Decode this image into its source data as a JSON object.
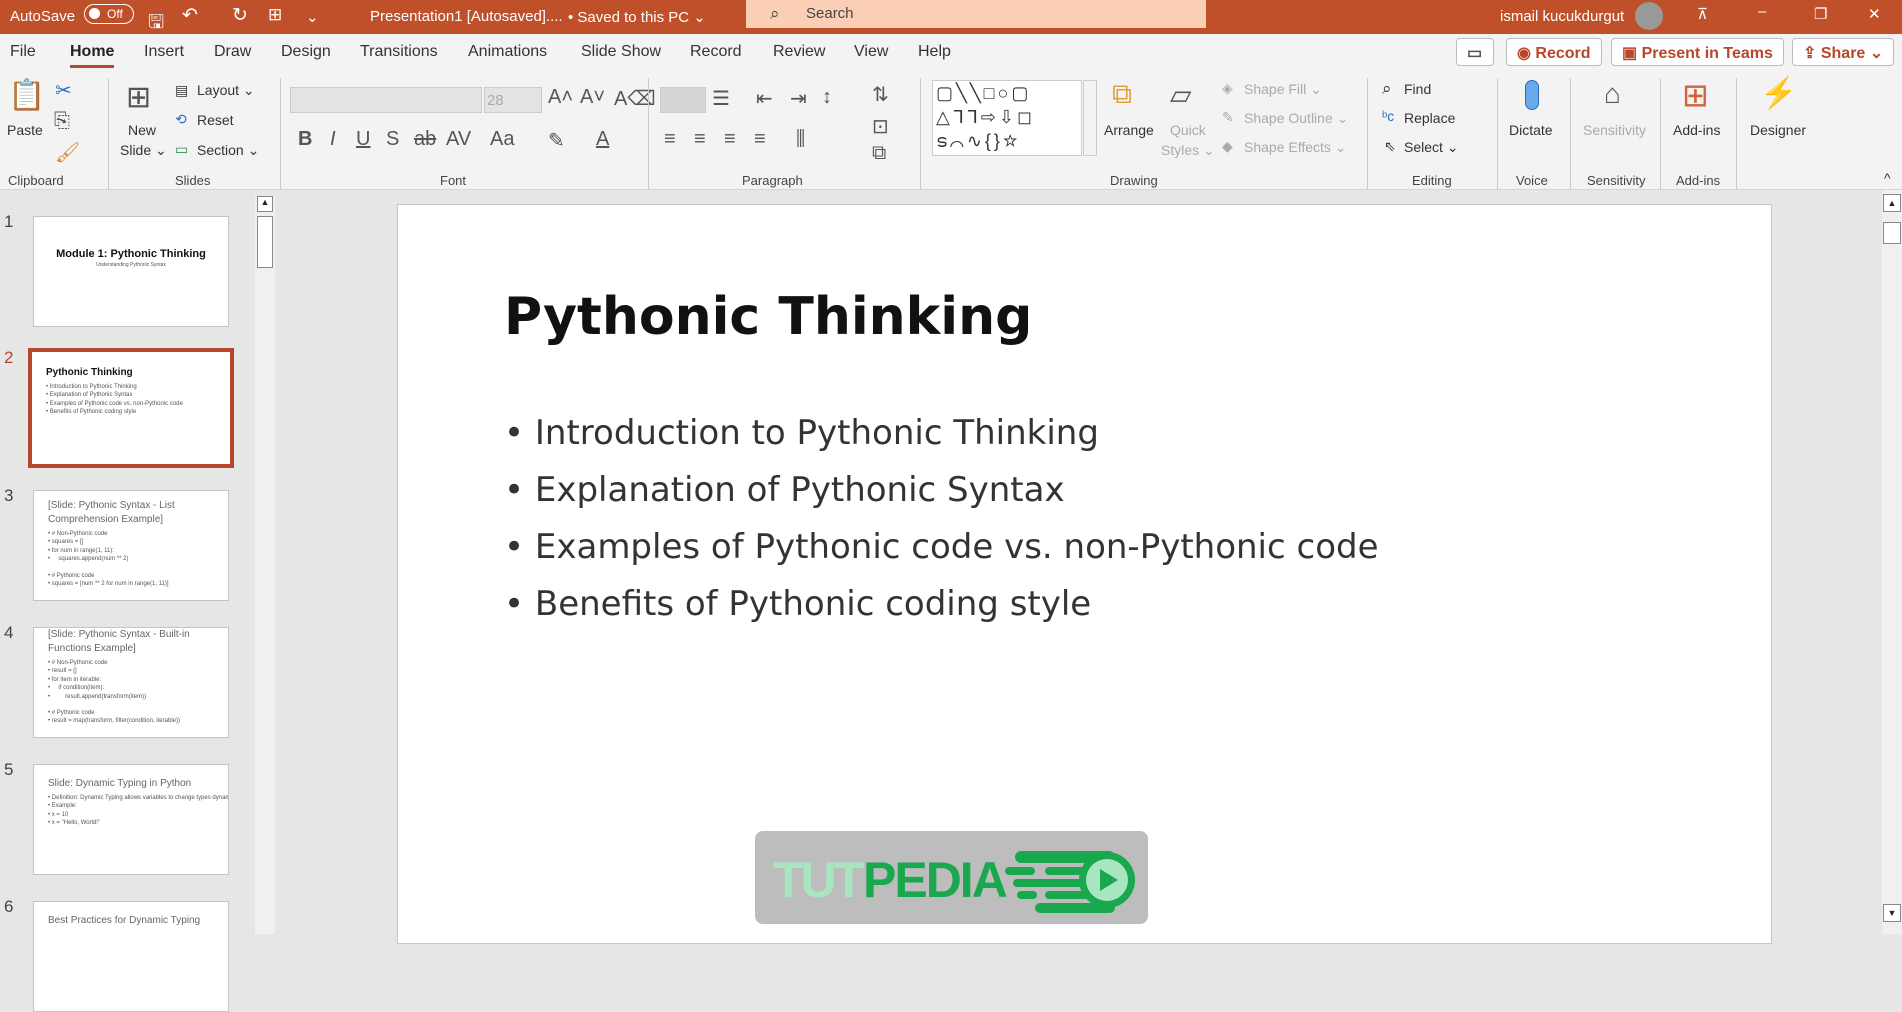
{
  "titlebar": {
    "autosave": "AutoSave",
    "autosave_state": "Off",
    "doc_title": "Presentation1 [Autosaved]....",
    "save_status": "• Saved to this PC ⌄",
    "search_placeholder": "Search",
    "user": "ismail kucukdurgut",
    "accent": "#c0502a"
  },
  "tabs": [
    "File",
    "Home",
    "Insert",
    "Draw",
    "Design",
    "Transitions",
    "Animations",
    "Slide Show",
    "Record",
    "Review",
    "View",
    "Help"
  ],
  "active_tab": "Home",
  "top_buttons": {
    "record": "Record",
    "present": "Present in Teams",
    "share": "Share"
  },
  "ribbon": {
    "clipboard": {
      "paste": "Paste",
      "label": "Clipboard"
    },
    "slides": {
      "new1": "New",
      "new2": "Slide ⌄",
      "layout": "Layout ⌄",
      "reset": "Reset",
      "section": "Section ⌄",
      "label": "Slides"
    },
    "font": {
      "size": "28",
      "label": "Font"
    },
    "paragraph": {
      "label": "Paragraph"
    },
    "drawing": {
      "arrange": "Arrange",
      "quick1": "Quick",
      "quick2": "Styles ⌄",
      "fill": "Shape Fill ⌄",
      "outline": "Shape Outline ⌄",
      "effects": "Shape Effects ⌄",
      "label": "Drawing"
    },
    "editing": {
      "find": "Find",
      "replace": "Replace",
      "select": "Select ⌄",
      "label": "Editing"
    },
    "voice": {
      "dictate": "Dictate",
      "label": "Voice"
    },
    "sensitivity": {
      "btn": "Sensitivity",
      "label": "Sensitivity"
    },
    "addins": {
      "btn": "Add-ins",
      "label": "Add-ins"
    },
    "designer": {
      "btn": "Designer"
    }
  },
  "thumbnails": [
    {
      "num": "1",
      "title": "Module 1: Pythonic Thinking",
      "lines": [
        "Understanding Pythonic Syntax"
      ]
    },
    {
      "num": "2",
      "title": "Pythonic Thinking",
      "lines": [
        "• Introduction to Pythonic Thinking",
        "• Explanation of Pythonic Syntax",
        "• Examples of Pythonic code vs. non-Pythonic code",
        "• Benefits of Pythonic coding style"
      ]
    },
    {
      "num": "3",
      "title": "[Slide: Pythonic Syntax - List Comprehension Example]",
      "lines": [
        "• # Non-Pythonic code",
        "• squares = []",
        "• for num in range(1, 11):",
        "•     squares.append(num ** 2)",
        "",
        "• # Pythonic code",
        "• squares = [num ** 2 for num in range(1, 11)]"
      ]
    },
    {
      "num": "4",
      "title": "[Slide: Pythonic Syntax - Built-in Functions Example]",
      "lines": [
        "• # Non-Pythonic code",
        "• result = []",
        "• for item in iterable:",
        "•     if condition(item):",
        "•         result.append(transform(item))",
        "",
        "• # Pythonic code",
        "• result = map(transform, filter(condition, iterable))"
      ]
    },
    {
      "num": "5",
      "title": "Slide: Dynamic Typing in Python",
      "lines": [
        "• Definition: Dynamic Typing allows variables to change types dynamically during runtime.",
        "• Example:",
        "• x = 10",
        "• x = \"Hello, World!\""
      ]
    },
    {
      "num": "6",
      "title": "Best Practices for Dynamic Typing",
      "lines": []
    }
  ],
  "slide": {
    "title": "Pythonic Thinking",
    "bullets": [
      "Introduction to Pythonic Thinking",
      "Explanation of Pythonic Syntax",
      "Examples of Pythonic code vs. non-Pythonic code",
      "Benefits of Pythonic coding style"
    ]
  },
  "watermark": {
    "text1": "TUT",
    "text2": "PEDIA"
  }
}
